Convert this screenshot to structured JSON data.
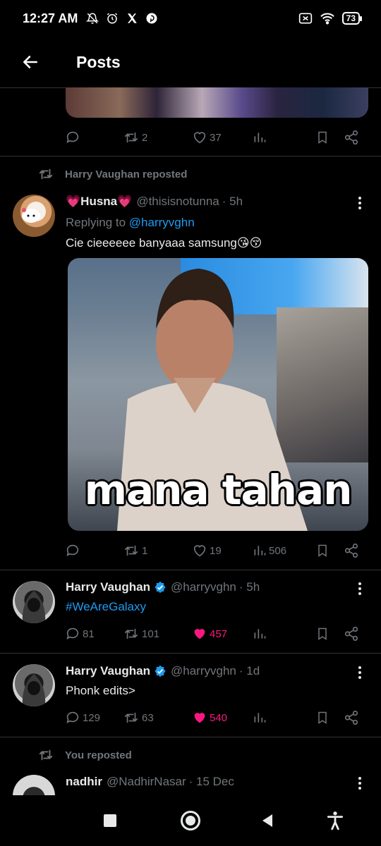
{
  "status_bar": {
    "time": "12:27 AM",
    "battery": "73"
  },
  "header": {
    "title": "Posts"
  },
  "post1": {
    "reply_count": "",
    "repost_count": "2",
    "like_count": "37",
    "view_count": ""
  },
  "post2": {
    "repost_label": "Harry Vaughan reposted",
    "name": "Husna",
    "handle": "@thisisnotunna",
    "time": "· 5h",
    "replying_prefix": "Replying to",
    "replying_to": "@harryvghn",
    "text": "Cie cieeeeee banyaaa samsung😘😚",
    "image_caption": "mana tahan",
    "repost_count": "1",
    "like_count": "19",
    "view_count": "506"
  },
  "post3": {
    "name": "Harry Vaughan",
    "handle": "@harryvghn",
    "time": "· 5h",
    "text": "#WeAreGalaxy",
    "reply_count": "81",
    "repost_count": "101",
    "like_count": "457"
  },
  "post4": {
    "name": "Harry Vaughan",
    "handle": "@harryvghn",
    "time": "· 1d",
    "text": "Phonk edits>",
    "reply_count": "129",
    "repost_count": "63",
    "like_count": "540"
  },
  "post5": {
    "repost_label": "You reposted",
    "name": "nadhir",
    "handle": "@NadhirNasar",
    "time": "· 15 Dec"
  },
  "colors": {
    "accent": "#1d9bf0",
    "like": "#f91880",
    "muted": "#71767b",
    "verified": "#1d9bf0"
  }
}
